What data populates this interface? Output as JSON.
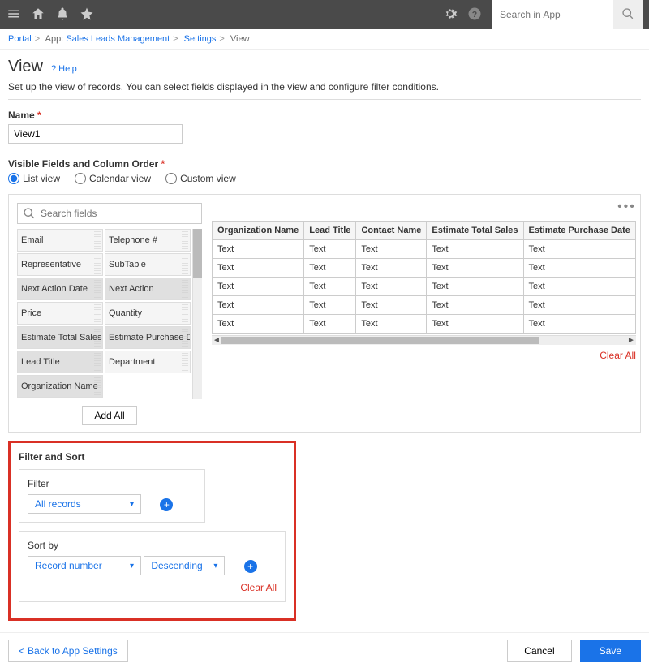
{
  "search_placeholder": "Search in App",
  "breadcrumb": {
    "portal": "Portal",
    "app_prefix": "App:",
    "app": "Sales Leads Management",
    "settings": "Settings",
    "view": "View"
  },
  "page_title": "View",
  "help": "? Help",
  "description": "Set up the view of records. You can select fields displayed in the view and configure filter conditions.",
  "name_label": "Name",
  "name_value": "View1",
  "visible_label": "Visible Fields and Column Order",
  "radios": {
    "list": "List view",
    "calendar": "Calendar view",
    "custom": "Custom view"
  },
  "search_fields_ph": "Search fields",
  "fields_left": [
    "Email",
    "Representative",
    "Next Action Date",
    "Price",
    "Estimate Total Sales",
    "Lead Title",
    "Organization Name"
  ],
  "fields_right": [
    "Telephone #",
    "SubTable",
    "Next Action",
    "Quantity",
    "Estimate Purchase D...",
    "Department"
  ],
  "add_all": "Add All",
  "columns": [
    "Organization Name",
    "Lead Title",
    "Contact Name",
    "Estimate Total Sales",
    "Estimate Purchase Date"
  ],
  "cell": "Text",
  "clear_all": "Clear All",
  "fs_heading": "Filter and Sort",
  "filter_label": "Filter",
  "filter_value": "All records",
  "sort_label": "Sort by",
  "sort_field": "Record number",
  "sort_dir": "Descending",
  "back": "Back to App Settings",
  "cancel": "Cancel",
  "save": "Save"
}
